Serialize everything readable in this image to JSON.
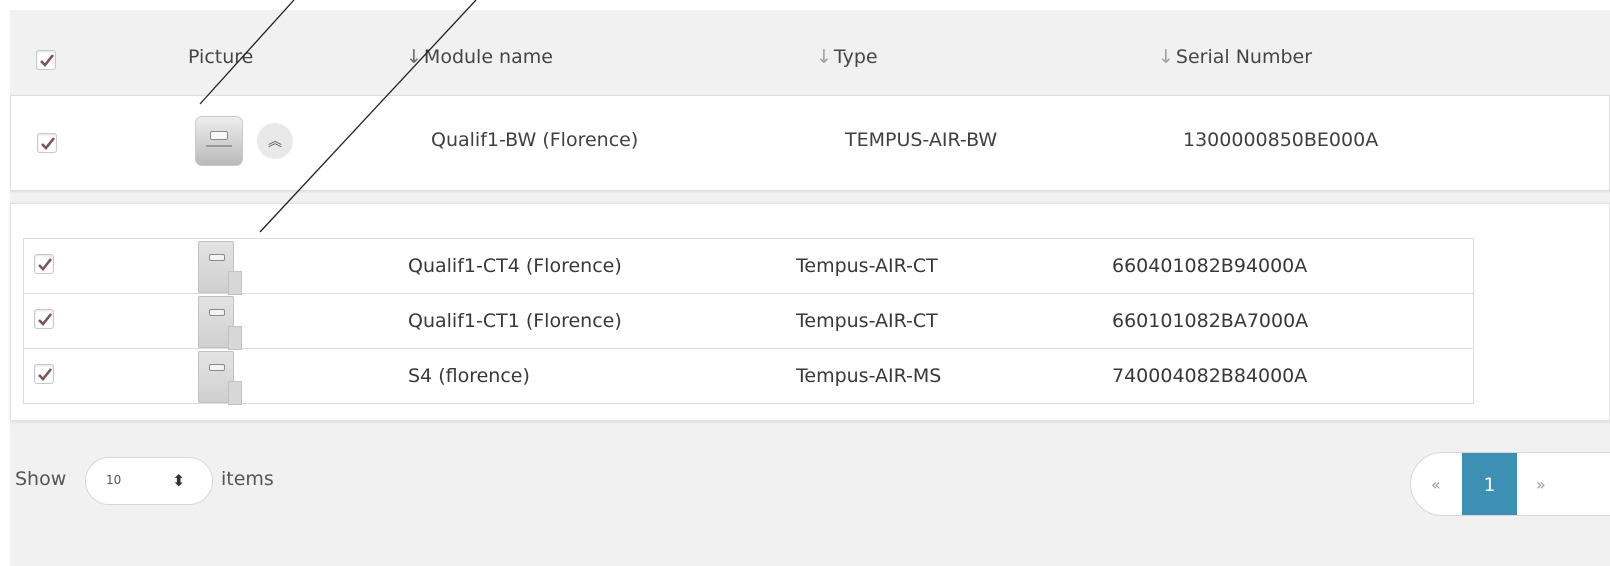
{
  "header": {
    "picture_label": "Picture",
    "module_label": "Module name",
    "type_label": "Type",
    "serial_label": "Serial Number",
    "sort_glyph": "↓"
  },
  "parent": {
    "module": "Qualif1-BW (Florence)",
    "type": "TEMPUS-AIR-BW",
    "serial": "1300000850BE000A",
    "collapse_glyph": "︽"
  },
  "children": [
    {
      "module": "Qualif1-CT4 (Florence)",
      "type": "Tempus-AIR-CT",
      "serial": "660401082B94000A"
    },
    {
      "module": "Qualif1-CT1 (Florence)",
      "type": "Tempus-AIR-CT",
      "serial": "660101082BA7000A"
    },
    {
      "module": "S4 (florence)",
      "type": "Tempus-AIR-MS",
      "serial": "740004082B84000A"
    }
  ],
  "footer": {
    "show_label": "Show",
    "page_size": "10",
    "items_label": "items",
    "prev": "«",
    "current_page": "1",
    "next": "»"
  },
  "colors": {
    "check": "#7a5656",
    "accent": "#3e8fb4"
  }
}
